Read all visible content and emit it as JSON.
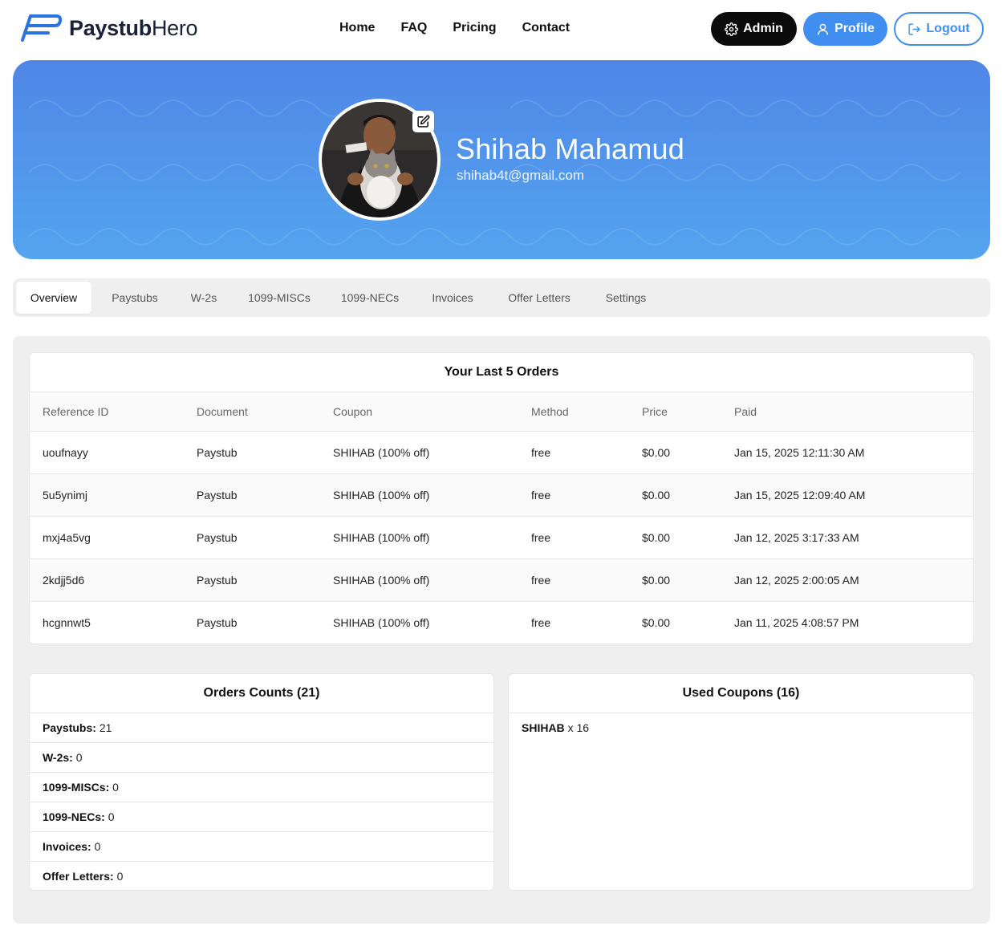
{
  "brand": {
    "name_bold": "Paystub",
    "name_light": "Hero",
    "color": "#1f6fe0"
  },
  "nav": {
    "links": [
      "Home",
      "FAQ",
      "Pricing",
      "Contact"
    ],
    "admin_label": "Admin",
    "profile_label": "Profile",
    "logout_label": "Logout"
  },
  "profile": {
    "name": "Shihab Mahamud",
    "email": "shihab4t@gmail.com"
  },
  "tabs": [
    "Overview",
    "Paystubs",
    "W-2s",
    "1099-MISCs",
    "1099-NECs",
    "Invoices",
    "Offer Letters",
    "Settings"
  ],
  "active_tab": "Overview",
  "orders": {
    "title": "Your Last 5 Orders",
    "columns": [
      "Reference ID",
      "Document",
      "Coupon",
      "Method",
      "Price",
      "Paid"
    ],
    "rows": [
      [
        "uoufnayy",
        "Paystub",
        "SHIHAB (100% off)",
        "free",
        "$0.00",
        "Jan 15, 2025 12:11:30 AM"
      ],
      [
        "5u5ynimj",
        "Paystub",
        "SHIHAB (100% off)",
        "free",
        "$0.00",
        "Jan 15, 2025 12:09:40 AM"
      ],
      [
        "mxj4a5vg",
        "Paystub",
        "SHIHAB (100% off)",
        "free",
        "$0.00",
        "Jan 12, 2025 3:17:33 AM"
      ],
      [
        "2kdjj5d6",
        "Paystub",
        "SHIHAB (100% off)",
        "free",
        "$0.00",
        "Jan 12, 2025 2:00:05 AM"
      ],
      [
        "hcgnnwt5",
        "Paystub",
        "SHIHAB (100% off)",
        "free",
        "$0.00",
        "Jan 11, 2025 4:08:57 PM"
      ]
    ]
  },
  "counts": {
    "title": "Orders Counts (21)",
    "items": [
      {
        "label": "Paystubs:",
        "value": "21"
      },
      {
        "label": "W-2s:",
        "value": "0"
      },
      {
        "label": "1099-MISCs:",
        "value": "0"
      },
      {
        "label": "1099-NECs:",
        "value": "0"
      },
      {
        "label": "Invoices:",
        "value": "0"
      },
      {
        "label": "Offer Letters:",
        "value": "0"
      }
    ]
  },
  "coupons": {
    "title": "Used Coupons (16)",
    "items": [
      {
        "code": "SHIHAB",
        "count": "x 16"
      }
    ]
  },
  "colors": {
    "accent": "#3f8ef0",
    "hero_top": "#4f86e6",
    "hero_bottom": "#54a4ef",
    "admin_bg": "#0b0b0b"
  },
  "icons": {
    "admin": "gear-icon",
    "profile": "user-icon",
    "logout": "logout-icon",
    "avatar_edit": "edit-icon"
  }
}
